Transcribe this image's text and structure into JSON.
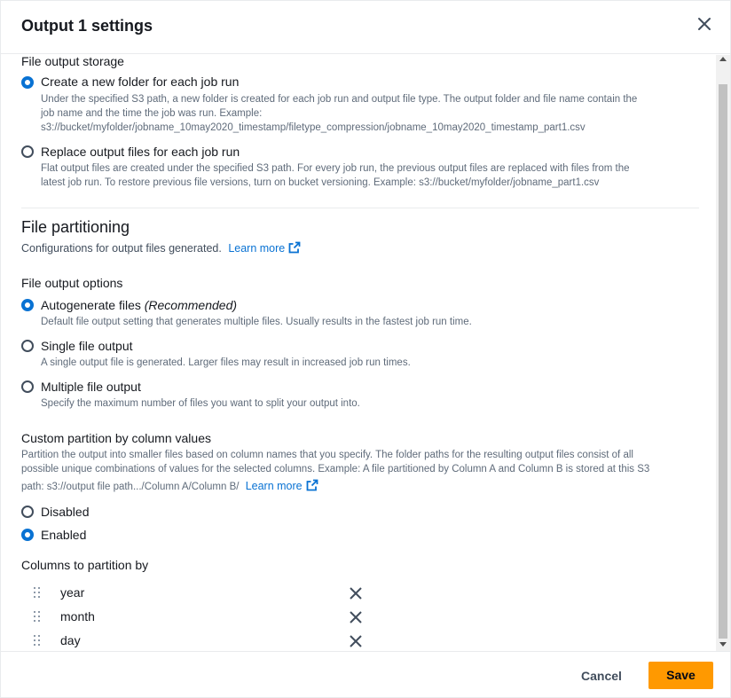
{
  "header": {
    "title": "Output 1 settings"
  },
  "storage": {
    "label": "File output storage",
    "options": [
      {
        "title": "Create a new folder for each job run",
        "checked": true,
        "desc1": "Under the specified S3 path, a new folder is created for each job run and output file type. The output folder and file name contain the",
        "desc2": "job name and the time the job was run. Example:",
        "desc3": "s3://bucket/myfolder/jobname_10may2020_timestamp/filetype_compression/jobname_10may2020_timestamp_part1.csv"
      },
      {
        "title": "Replace output files for each job run",
        "checked": false,
        "desc1": "Flat output files are created under the specified S3 path. For every job run, the previous output files are replaced with files from the",
        "desc2": "latest job run. To restore previous file versions, turn on bucket versioning. Example: s3://bucket/myfolder/jobname_part1.csv"
      }
    ]
  },
  "partitioning": {
    "heading": "File partitioning",
    "desc": "Configurations for output files generated.",
    "learn_more": "Learn more"
  },
  "file_output_options": {
    "label": "File output options",
    "options": [
      {
        "title": "Autogenerate files",
        "title_em": "(Recommended)",
        "checked": true,
        "desc": "Default file output setting that generates multiple files. Usually results in the fastest job run time."
      },
      {
        "title": "Single file output",
        "checked": false,
        "desc": "A single output file is generated. Larger files may result in increased job run times."
      },
      {
        "title": "Multiple file output",
        "checked": false,
        "desc": "Specify the maximum number of files you want to split your output into."
      }
    ]
  },
  "custom_partition": {
    "label": "Custom partition by column values",
    "desc1": "Partition the output into smaller files based on column names that you specify. The folder paths for the resulting output files consist of all",
    "desc2": "possible unique combinations of values for the selected columns. Example: A file partitioned by Column A and Column B is stored at this S3",
    "desc3": "path: s3://output file path.../Column A/Column B/",
    "learn_more": "Learn more",
    "options": [
      {
        "title": "Disabled",
        "checked": false
      },
      {
        "title": "Enabled",
        "checked": true
      }
    ]
  },
  "columns": {
    "label": "Columns to partition by",
    "items": [
      "year",
      "month",
      "day"
    ]
  },
  "footer": {
    "cancel_label": "Cancel",
    "save_label": "Save"
  },
  "colors": {
    "accent": "#0972d3",
    "primary_button": "#ff9900",
    "text": "#16191f",
    "muted": "#5f6b7a"
  }
}
